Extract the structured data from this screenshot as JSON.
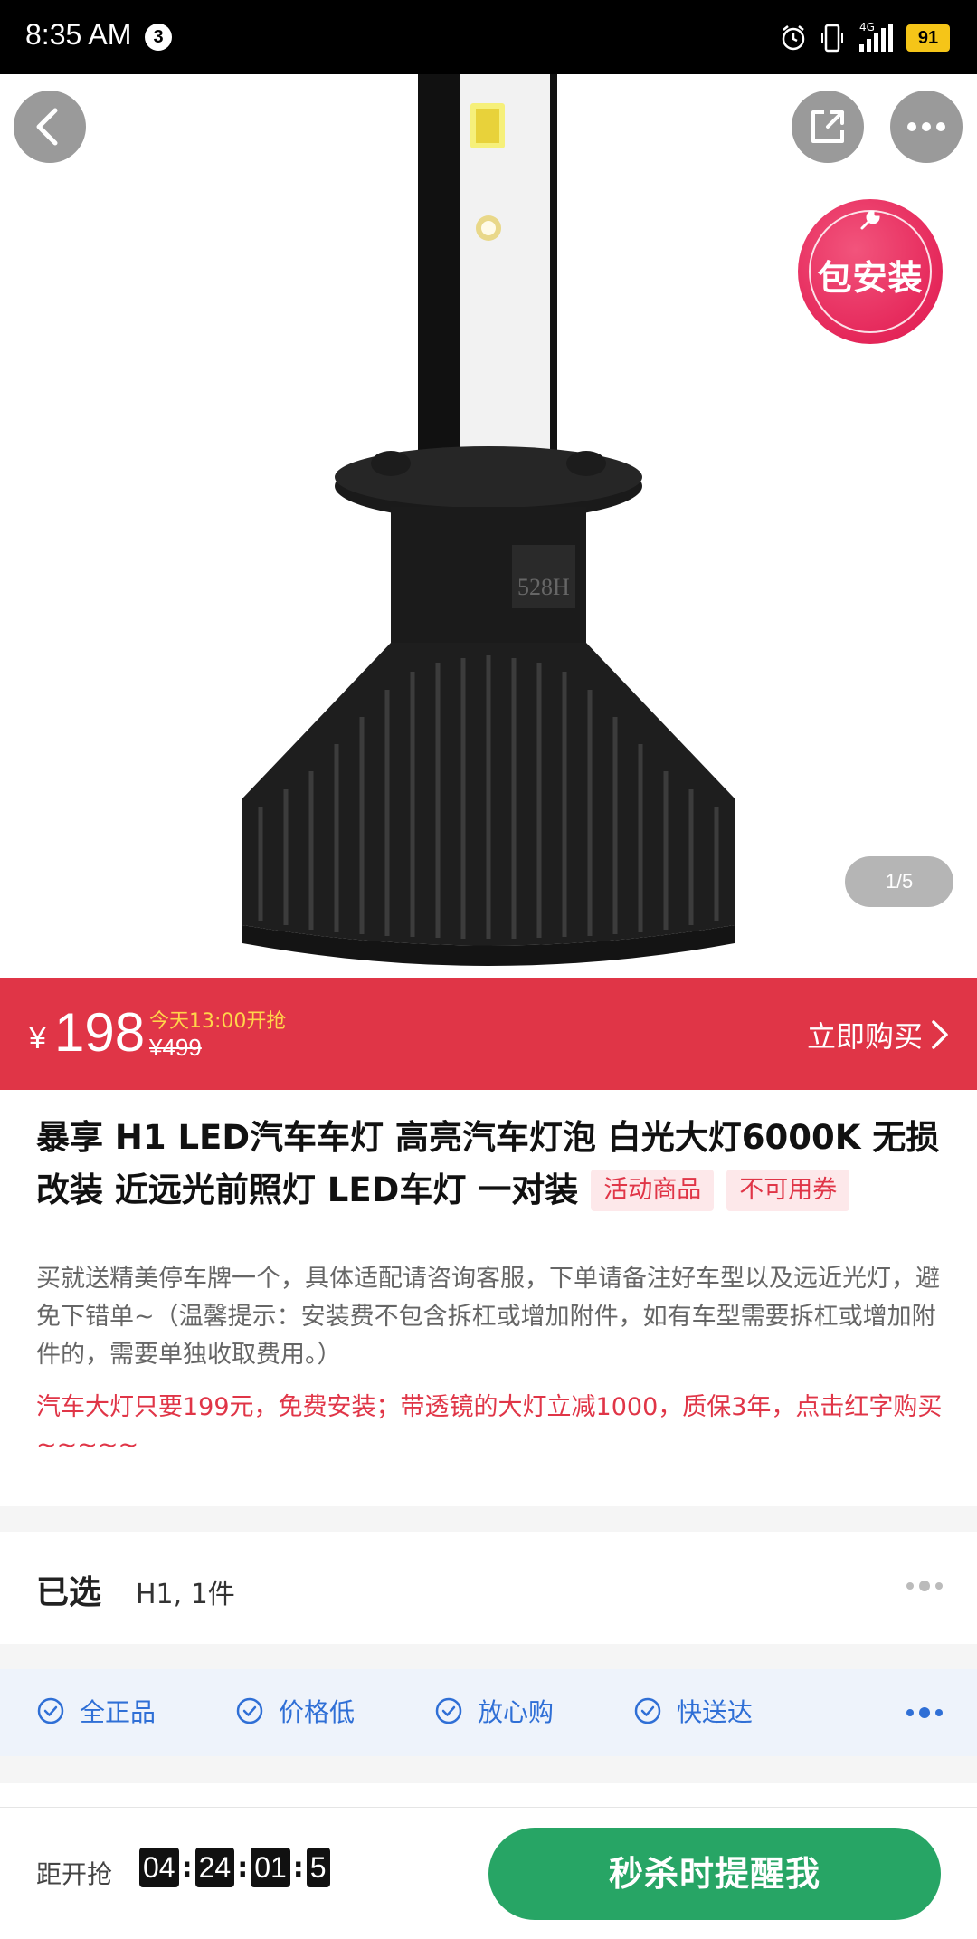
{
  "status_bar": {
    "time": "8:35 AM",
    "notification_count": "3",
    "network": "4G",
    "battery": "91"
  },
  "gallery": {
    "counter": "1/5",
    "install_badge": "包安装"
  },
  "price_bar": {
    "currency": "¥",
    "price": "198",
    "start_time": "今天13:00开抢",
    "original_price": "¥499",
    "buy_now_label": "立即购买"
  },
  "product": {
    "title": "暴享 H1 LED汽车车灯 高亮汽车灯泡 白光大灯6000K 无损改装 近远光前照灯 LED车灯 一对装",
    "tags": [
      "活动商品",
      "不可用券"
    ],
    "description": "买就送精美停车牌一个，具体适配请咨询客服，下单请备注好车型以及远近光灯，避免下错单~（温馨提示：安装费不包含拆杠或增加附件，如有车型需要拆杠或增加附件的，需要单独收取费用。）",
    "promo_text": "汽车大灯只要199元，免费安装；带透镜的大灯立减1000，质保3年，点击红字购买~~~~~"
  },
  "selection": {
    "label": "已选",
    "value": "H1, 1件"
  },
  "guarantees": [
    "全正品",
    "价格低",
    "放心购",
    "快送达"
  ],
  "bottom_bar": {
    "countdown_label": "距开抢",
    "countdown": [
      "04",
      "24",
      "01",
      "5"
    ],
    "remind_button": "秒杀时提醒我"
  },
  "colors": {
    "accent_red": "#e03547",
    "accent_green": "#27a565",
    "accent_blue": "#2f6fd6",
    "badge_pink": "#e5275a"
  }
}
